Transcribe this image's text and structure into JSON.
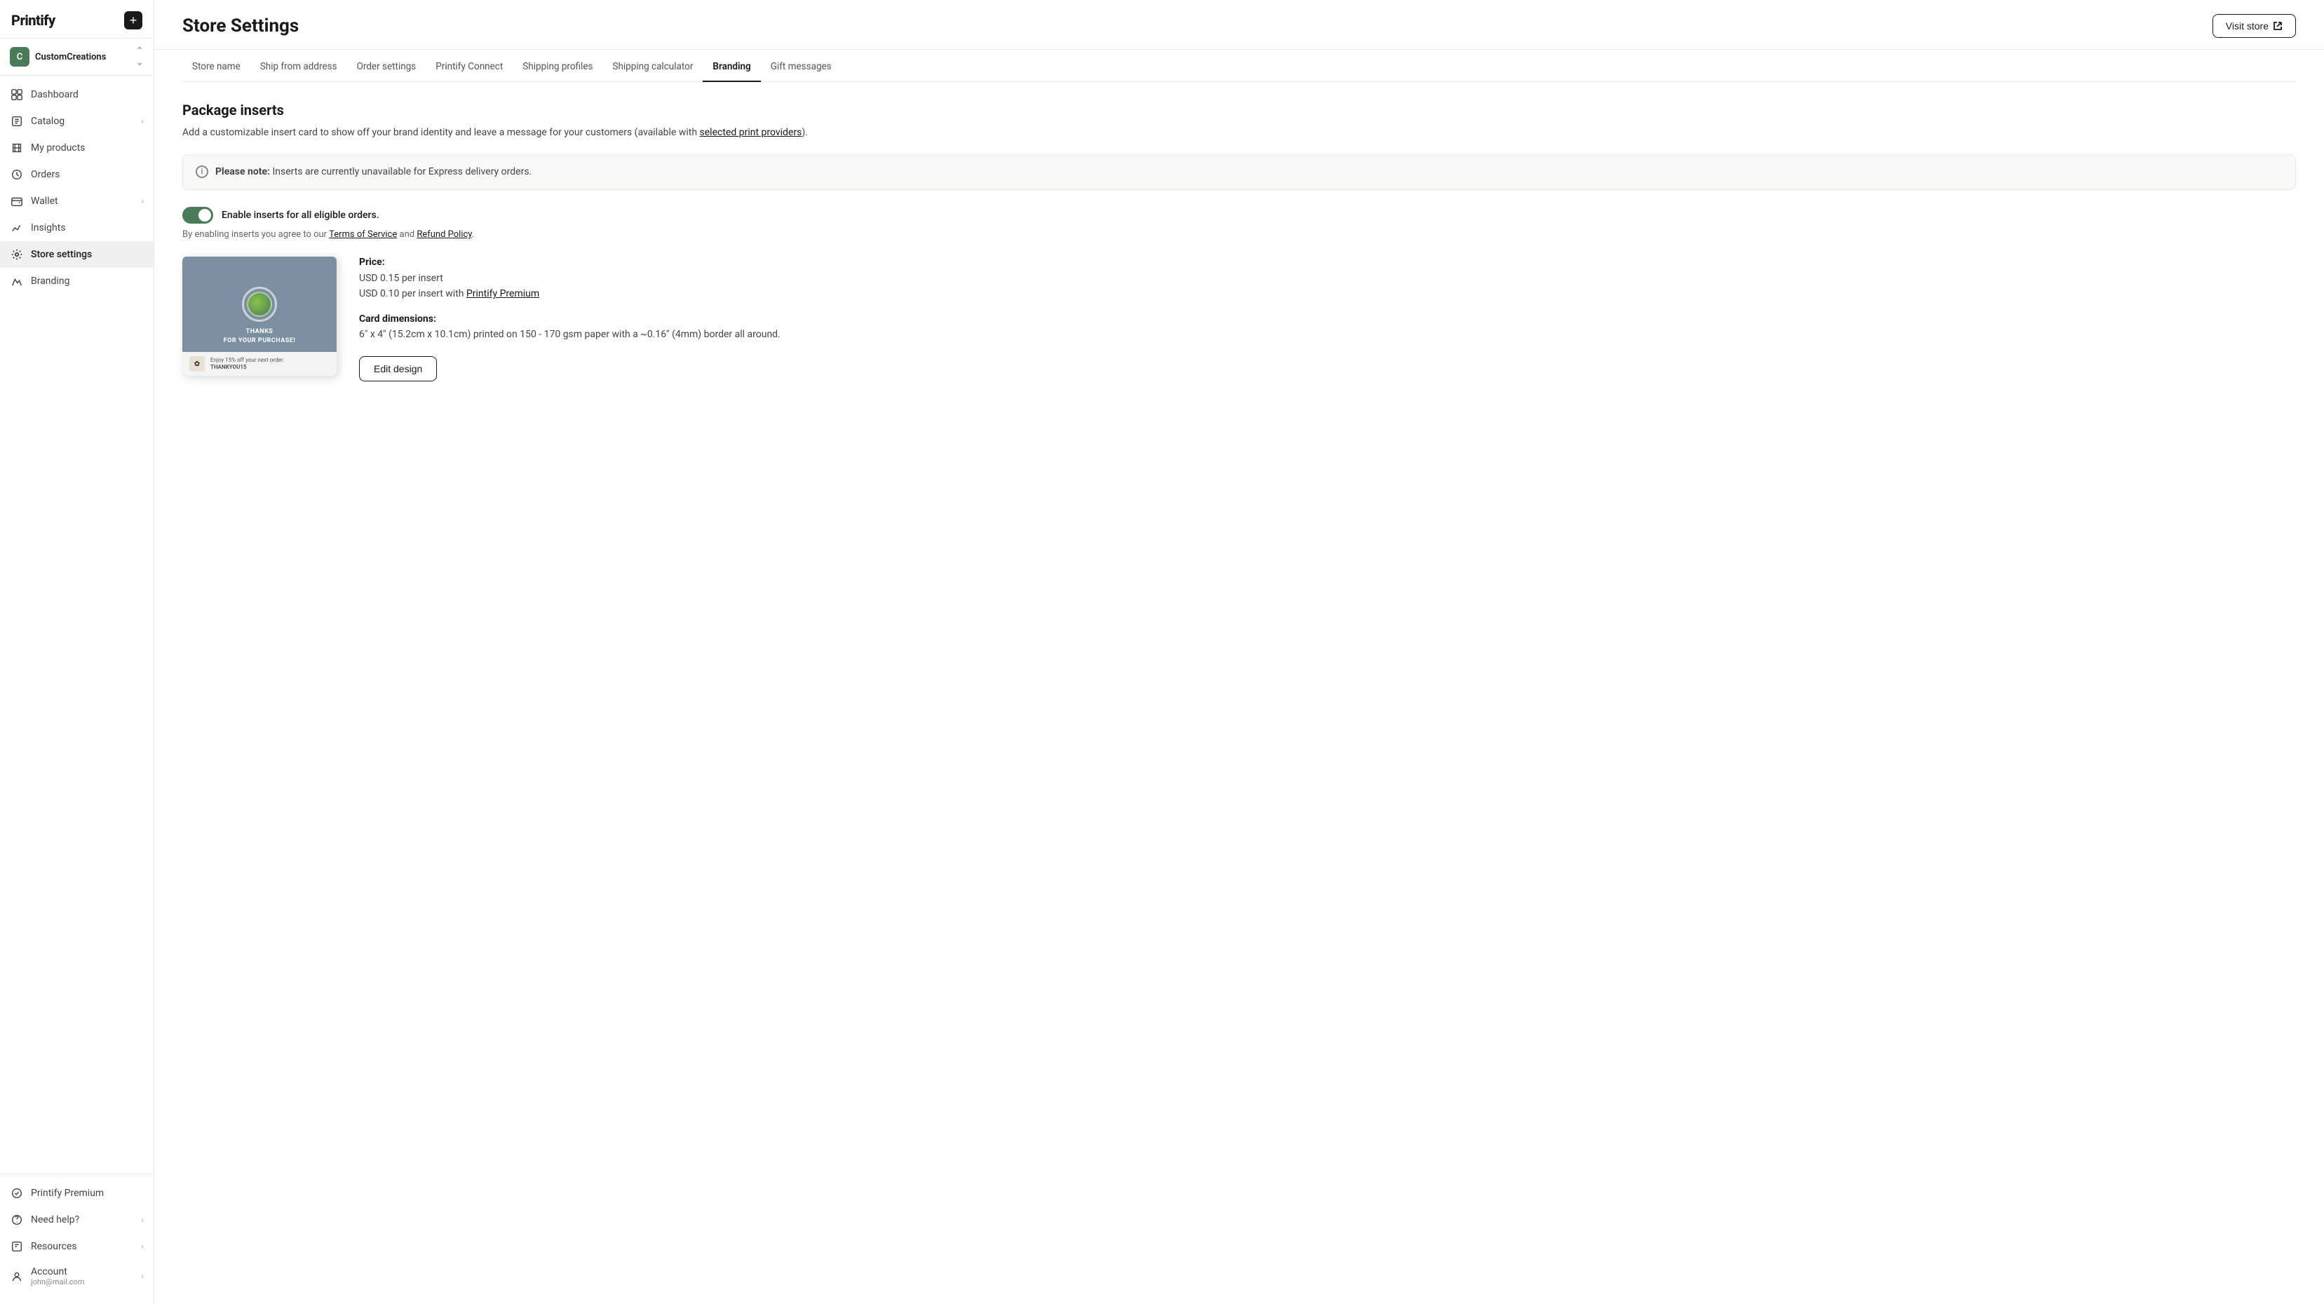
{
  "brand": {
    "logo": "Printify",
    "add_button_label": "+"
  },
  "store": {
    "name": "CustomCreations",
    "icon_letter": "C"
  },
  "sidebar": {
    "nav_items": [
      {
        "id": "dashboard",
        "label": "Dashboard",
        "icon": "dashboard",
        "has_chevron": false,
        "active": false
      },
      {
        "id": "catalog",
        "label": "Catalog",
        "icon": "catalog",
        "has_chevron": true,
        "active": false
      },
      {
        "id": "my-products",
        "label": "My products",
        "icon": "products",
        "has_chevron": false,
        "active": false
      },
      {
        "id": "orders",
        "label": "Orders",
        "icon": "orders",
        "has_chevron": false,
        "active": false
      },
      {
        "id": "wallet",
        "label": "Wallet",
        "icon": "wallet",
        "has_chevron": true,
        "active": false
      },
      {
        "id": "insights",
        "label": "Insights",
        "icon": "insights",
        "has_chevron": false,
        "active": false
      },
      {
        "id": "store-settings",
        "label": "Store settings",
        "icon": "store-settings",
        "has_chevron": false,
        "active": true
      },
      {
        "id": "branding",
        "label": "Branding",
        "icon": "branding",
        "has_chevron": false,
        "active": false
      }
    ],
    "bottom_items": [
      {
        "id": "printify-premium",
        "label": "Printify Premium",
        "icon": "premium",
        "has_chevron": false
      },
      {
        "id": "need-help",
        "label": "Need help?",
        "icon": "help",
        "has_chevron": true
      },
      {
        "id": "resources",
        "label": "Resources",
        "icon": "resources",
        "has_chevron": true
      },
      {
        "id": "account",
        "label": "Account",
        "icon": "account",
        "has_chevron": true,
        "subtitle": "john@mail.com"
      }
    ]
  },
  "header": {
    "title": "Store Settings",
    "visit_store_label": "Visit store"
  },
  "tabs": [
    {
      "id": "store-name",
      "label": "Store name",
      "active": false
    },
    {
      "id": "ship-from",
      "label": "Ship from address",
      "active": false
    },
    {
      "id": "order-settings",
      "label": "Order settings",
      "active": false
    },
    {
      "id": "printify-connect",
      "label": "Printify Connect",
      "active": false
    },
    {
      "id": "shipping-profiles",
      "label": "Shipping profiles",
      "active": false
    },
    {
      "id": "shipping-calculator",
      "label": "Shipping calculator",
      "active": false
    },
    {
      "id": "branding",
      "label": "Branding",
      "active": true
    },
    {
      "id": "gift-messages",
      "label": "Gift messages",
      "active": false
    }
  ],
  "content": {
    "section_title": "Package inserts",
    "section_desc_prefix": "Add a customizable insert card to show off your brand identity and leave a message for your customers (available with ",
    "section_desc_link": "selected print providers",
    "section_desc_suffix": ").",
    "notice_text_bold": "Please note:",
    "notice_text": " Inserts are currently unavailable for Express delivery orders.",
    "toggle_label": "Enable inserts for all eligible orders.",
    "terms_prefix": "By enabling inserts you agree to our ",
    "terms_link1": "Terms of Service",
    "terms_and": " and ",
    "terms_link2": "Refund Policy",
    "terms_suffix": ".",
    "price": {
      "label": "Price:",
      "line1": "USD 0.15 per insert",
      "line2_prefix": "USD 0.10 per insert with ",
      "line2_link": "Printify Premium"
    },
    "dimensions": {
      "label": "Card dimensions:",
      "text": "6\" x 4\" (15.2cm x 10.1cm) printed on 150 - 170 gsm paper with a ~0.16\" (4mm) border all around."
    },
    "edit_design_label": "Edit design",
    "card_preview": {
      "thanks_line1": "THANKS",
      "thanks_line2": "FOR YOUR PURCHASE!",
      "promo_line1": "Enjoy 15% off your next order:",
      "promo_code": "THANKYOU15"
    }
  }
}
